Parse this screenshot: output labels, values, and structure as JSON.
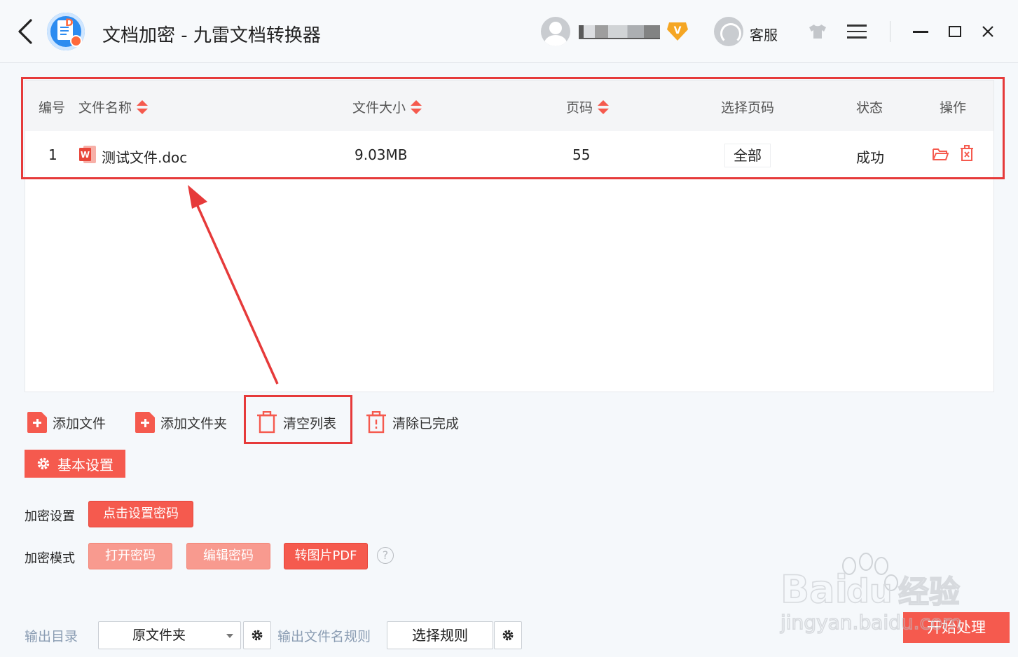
{
  "titlebar": {
    "title": "文档加密 - 九雷文档转换器",
    "service_label": "客服",
    "vip_badge": "V"
  },
  "table": {
    "headers": {
      "index": "编号",
      "filename": "文件名称",
      "filesize": "文件大小",
      "pages": "页码",
      "select_pages": "选择页码",
      "status": "状态",
      "actions": "操作"
    },
    "rows": [
      {
        "index": "1",
        "filename": "测试文件.doc",
        "filesize": "9.03MB",
        "pages": "55",
        "select_pages": "全部",
        "status": "成功"
      }
    ]
  },
  "toolbar": {
    "add_file": "添加文件",
    "add_folder": "添加文件夹",
    "clear_list": "清空列表",
    "clear_done": "清除已完成"
  },
  "settings": {
    "basic_settings": "基本设置",
    "encrypt_settings_label": "加密设置",
    "set_password_button": "点击设置密码",
    "encrypt_mode_label": "加密模式",
    "modes": [
      "打开密码",
      "编辑密码",
      "转图片PDF"
    ],
    "help": "?"
  },
  "output": {
    "dir_label": "输出目录",
    "dir_value": "原文件夹",
    "name_rule_label": "输出文件名规则",
    "choose_rule": "选择规则",
    "start": "开始处理"
  },
  "watermark": {
    "line1": "Bai",
    "line1b": "du",
    "line1c": "经验",
    "line2": "jingyan.baidu.com"
  },
  "colors": {
    "accent": "#f55a4e",
    "highlight": "#e63a3a",
    "muted_label": "#8b9db3"
  }
}
